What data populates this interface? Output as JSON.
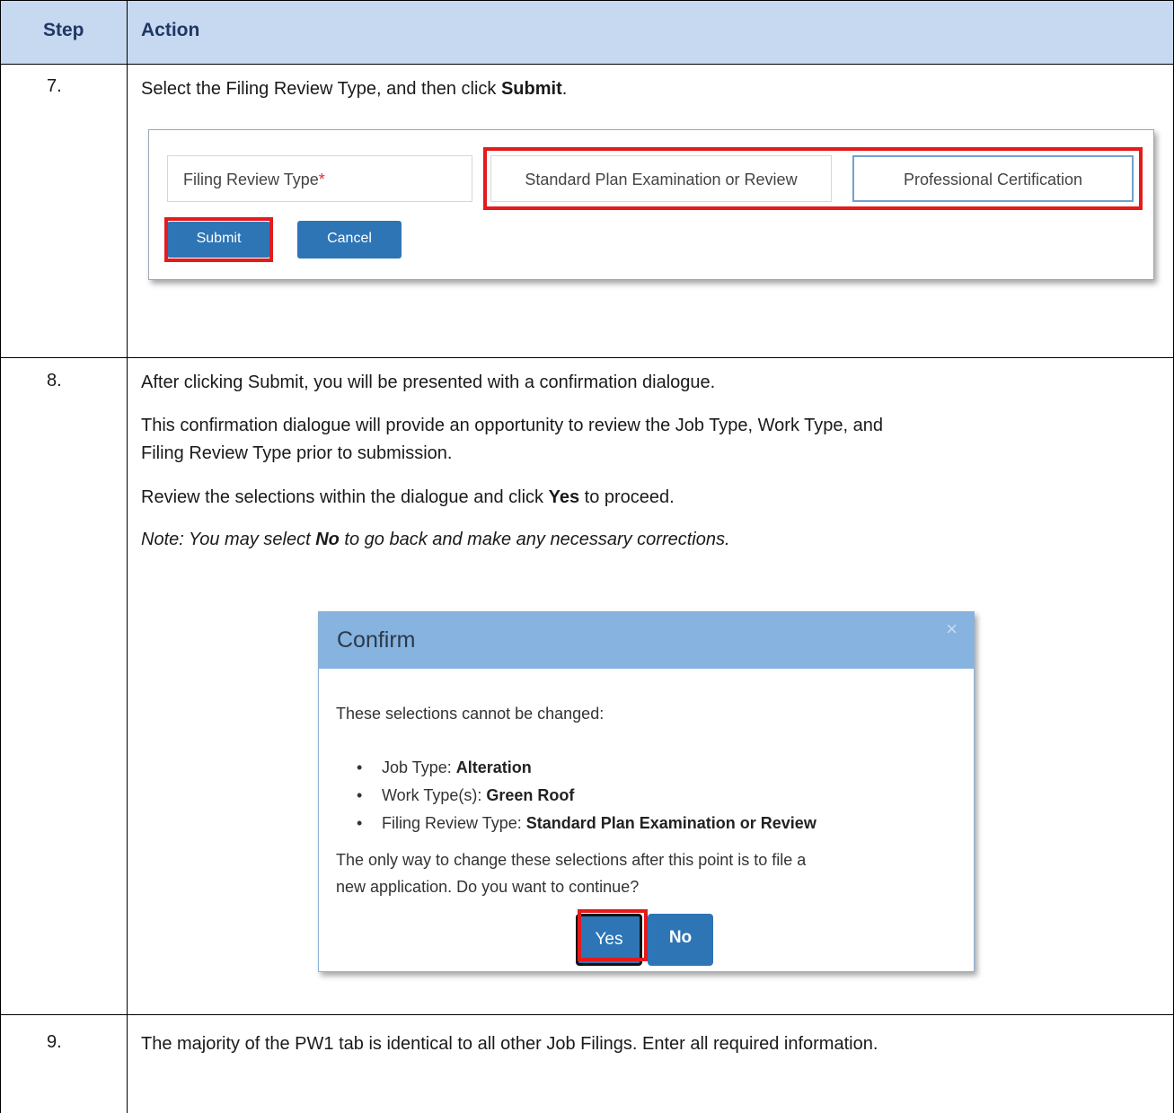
{
  "header": {
    "step_col": "Step",
    "action_col": "Action"
  },
  "step7": {
    "number": "7.",
    "instruction_pre": "Select the Filing Review Type, and then click ",
    "instruction_bold": "Submit",
    "instruction_post": ".",
    "screenshot": {
      "field_label": "Filing Review Type",
      "required_marker": "*",
      "option_standard": "Standard Plan Examination or Review",
      "option_professional": "Professional Certification",
      "submit_label": "Submit",
      "cancel_label": "Cancel"
    }
  },
  "step8": {
    "number": "8.",
    "para1": "After clicking Submit, you will be presented with a confirmation dialogue.",
    "para2_line1": "This confirmation dialogue will provide an opportunity to review the Job Type, Work Type, and",
    "para2_line2": "Filing Review Type prior to submission.",
    "para3_pre": "Review the selections within the dialogue and click ",
    "para3_bold": "Yes",
    "para3_post": " to proceed.",
    "note_pre": "Note: You may select ",
    "note_bold": "No",
    "note_post": " to go back and make any necessary corrections.",
    "dialog": {
      "title": "Confirm",
      "close_glyph": "×",
      "intro": "These selections cannot be changed:",
      "items": [
        {
          "label": "Job Type: ",
          "value": "Alteration"
        },
        {
          "label": "Work Type(s): ",
          "value": "Green Roof"
        },
        {
          "label": "Filing Review Type: ",
          "value": "Standard Plan Examination or Review"
        }
      ],
      "outro_line1": "The only way to change these selections after this point is to file a",
      "outro_line2": "new application. Do you want to continue?",
      "yes_label": "Yes",
      "no_label": "No"
    }
  },
  "step9": {
    "number": "9.",
    "text": "The majority of the PW1 tab is identical to all other Job Filings. Enter all required information."
  },
  "colors": {
    "header_bg": "#c6d9f1",
    "button_blue": "#2e75b6",
    "highlight_red": "#e31b1b",
    "dialog_header": "#87b3e0"
  }
}
